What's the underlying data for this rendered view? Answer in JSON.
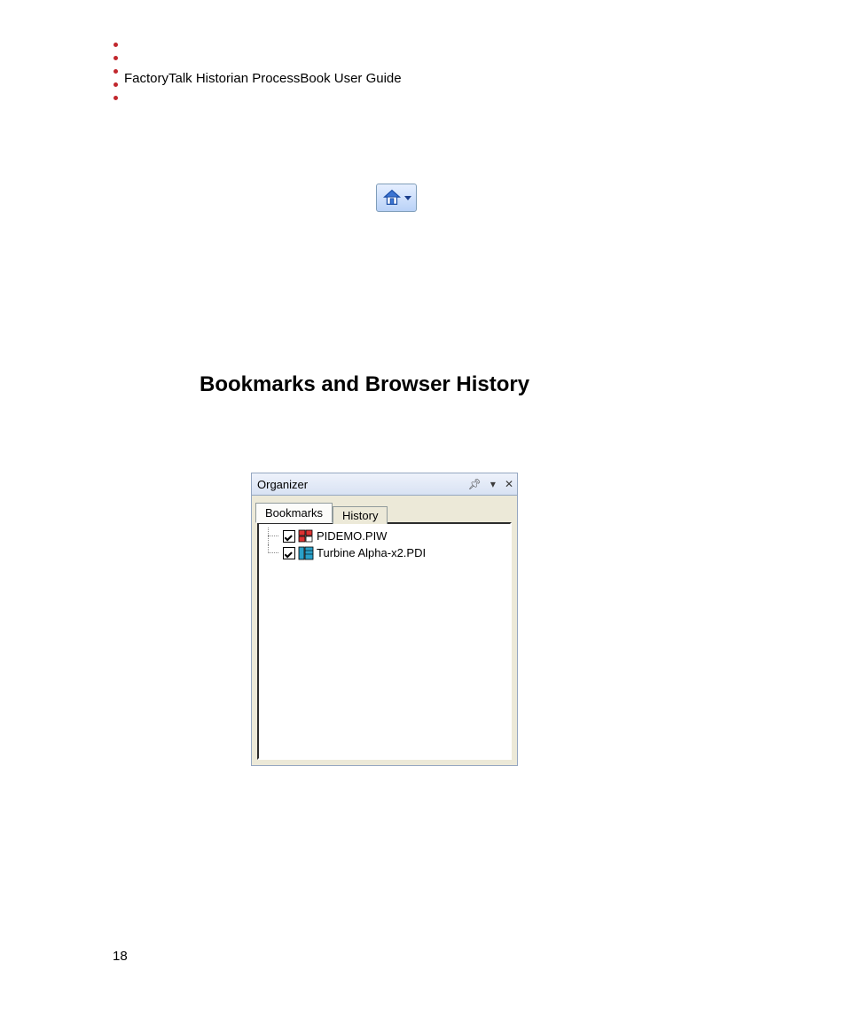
{
  "running_header": "FactoryTalk Historian ProcessBook User Guide",
  "section_heading": "Bookmarks and Browser History",
  "organizer": {
    "title": "Organizer",
    "tabs": {
      "bookmarks": "Bookmarks",
      "history": "History"
    },
    "items": [
      {
        "label": "PIDEMO.PIW"
      },
      {
        "label": "Turbine Alpha-x2.PDI"
      }
    ]
  },
  "page_number": "18"
}
